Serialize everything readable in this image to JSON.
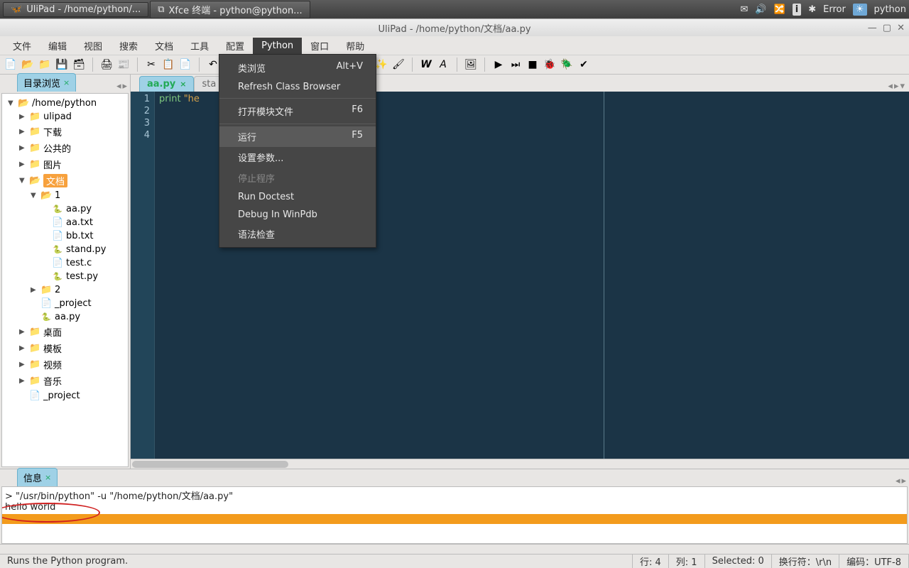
{
  "taskbar": {
    "app1": "UliPad - /home/python/...",
    "app2": "Xfce 终端 - python@python...",
    "error": "Error",
    "user": "python"
  },
  "window": {
    "title": "UliPad - /home/python/文档/aa.py"
  },
  "menubar": {
    "file": "文件",
    "edit": "编辑",
    "view": "视图",
    "search": "搜索",
    "doc": "文档",
    "tool": "工具",
    "config": "配置",
    "python": "Python",
    "window": "窗口",
    "help": "帮助"
  },
  "python_menu": {
    "class_browse": "类浏览",
    "class_browse_key": "Alt+V",
    "refresh": "Refresh Class Browser",
    "open_module": "打开模块文件",
    "open_module_key": "F6",
    "run": "运行",
    "run_key": "F5",
    "set_args": "设置参数...",
    "stop": "停止程序",
    "doctest": "Run Doctest",
    "debug": "Debug In WinPdb",
    "syntax": "语法检查"
  },
  "side": {
    "tab": "目录浏览",
    "root": "/home/python",
    "nodes": {
      "ulipad": "ulipad",
      "downloads": "下载",
      "public": "公共的",
      "pictures": "图片",
      "docs": "文档",
      "one": "1",
      "aa_py": "aa.py",
      "aa_txt": "aa.txt",
      "bb_txt": "bb.txt",
      "stand_py": "stand.py",
      "test_c": "test.c",
      "test_py": "test.py",
      "two": "2",
      "project1": "_project",
      "aa_py2": "aa.py",
      "desktop": "桌面",
      "templates": "模板",
      "videos": "视频",
      "music": "音乐",
      "project2": "_project"
    }
  },
  "editor": {
    "tab1": "aa.py",
    "tab2": "sta",
    "line_nums": [
      "1",
      "2",
      "3",
      "4"
    ],
    "code_kw": "print",
    "code_str": "\"he"
  },
  "bottom": {
    "tab": "信息",
    "line1": "> \"/usr/bin/python\" -u \"/home/python/文档/aa.py\"",
    "line2": "hello world"
  },
  "status": {
    "hint": "Runs the Python program.",
    "row": "行: 4",
    "col": "列: 1",
    "sel": "Selected: 0",
    "eol": "换行符：\\r\\n",
    "enc": "编码：UTF-8"
  }
}
